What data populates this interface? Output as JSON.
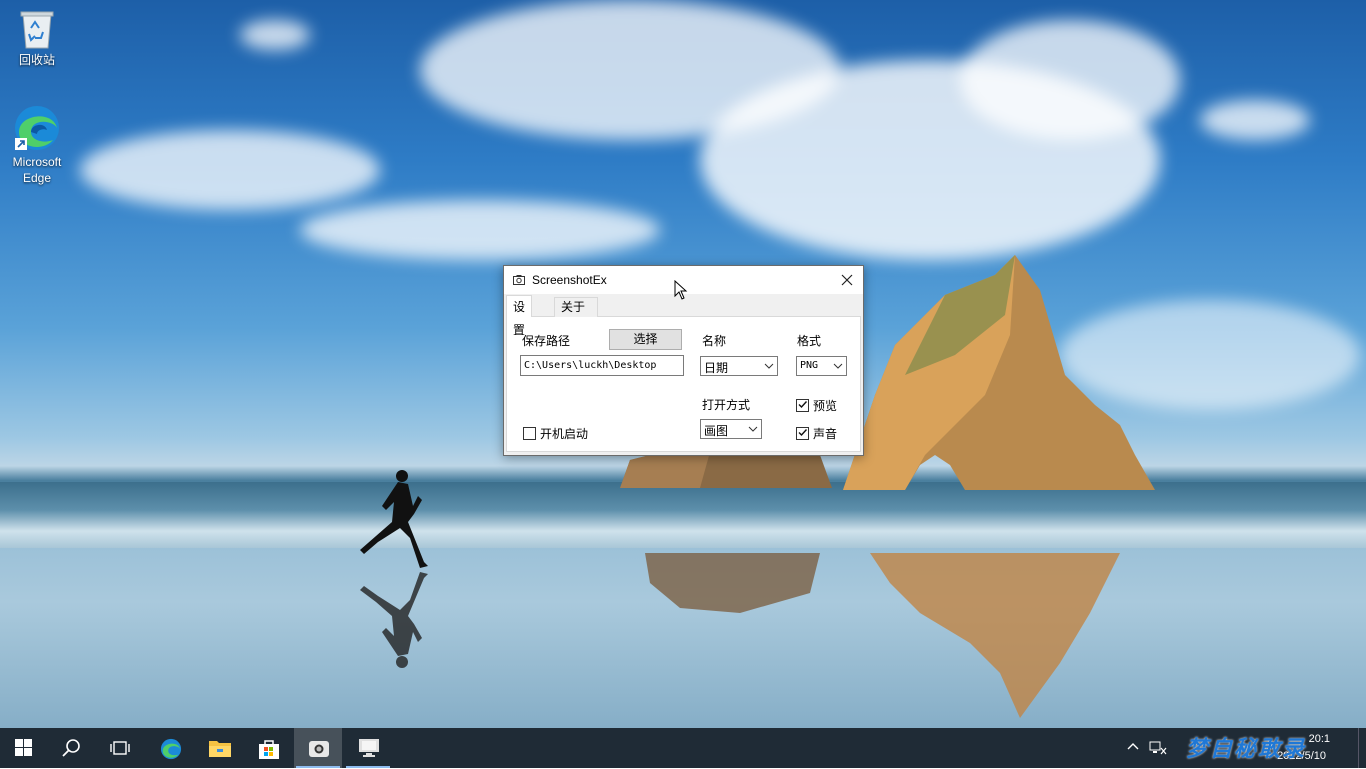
{
  "desktop": {
    "icons": [
      {
        "label": "回收站",
        "icon": "recycle-bin-icon"
      },
      {
        "label": "Microsoft\nEdge",
        "label_line1": "Microsoft",
        "label_line2": "Edge",
        "icon": "edge-icon"
      }
    ]
  },
  "dialog": {
    "title": "ScreenshotEx",
    "tabs": [
      {
        "label": "设置",
        "active": true
      },
      {
        "label": "关于",
        "active": false
      }
    ],
    "settings": {
      "save_path_label": "保存路径",
      "choose_button": "选择",
      "save_path_value": "C:\\Users\\luckh\\Desktop",
      "name_label": "名称",
      "name_value": "日期",
      "format_label": "格式",
      "format_value": "PNG",
      "open_with_label": "打开方式",
      "open_with_value": "画图",
      "autostart_label": "开机启动",
      "autostart_checked": false,
      "preview_label": "预览",
      "preview_checked": true,
      "sound_label": "声音",
      "sound_checked": true
    }
  },
  "taskbar": {
    "items": [
      "start-icon",
      "search-icon",
      "task-view-icon",
      "edge-icon",
      "file-explorer-icon",
      "store-icon",
      "screenshotex-icon",
      "monitor-app-icon"
    ],
    "tray": {
      "time": "20:1",
      "date": "2022/5/10"
    }
  },
  "watermark": "梦自秘敢录",
  "colors": {
    "taskbar": "#1f2b36",
    "dialog_bg": "#f0f0f0",
    "accent": "#8fbcef"
  }
}
